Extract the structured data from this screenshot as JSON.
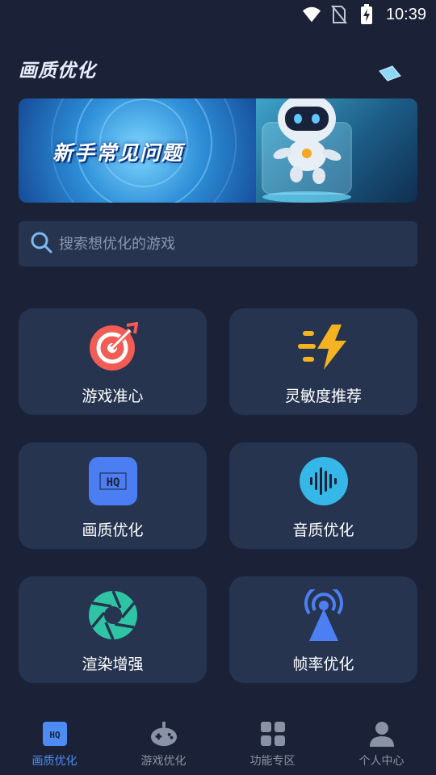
{
  "status_bar": {
    "time": "10:39",
    "icons": [
      "wifi-icon",
      "no-sim-icon",
      "battery-charging-icon"
    ]
  },
  "header": {
    "title": "画质优化"
  },
  "banner": {
    "text": "新手常见问题",
    "image": "robot-mascot"
  },
  "search": {
    "placeholder": "搜索想优化的游戏",
    "value": ""
  },
  "features": [
    {
      "label": "游戏准心",
      "icon": "crosshair-target-icon",
      "color": "#f25c54"
    },
    {
      "label": "灵敏度推荐",
      "icon": "lightning-speed-icon",
      "color": "#f5b321"
    },
    {
      "label": "画质优化",
      "icon": "hq-icon",
      "color": "#4b7ef2"
    },
    {
      "label": "音质优化",
      "icon": "sound-wave-icon",
      "color": "#35b8e8"
    },
    {
      "label": "渲染增强",
      "icon": "aperture-icon",
      "color": "#2ec4a4"
    },
    {
      "label": "帧率优化",
      "icon": "signal-tower-icon",
      "color": "#4d7ff3"
    }
  ],
  "bottom_nav": {
    "active": 0,
    "items": [
      {
        "label": "画质优化",
        "icon": "hq-icon"
      },
      {
        "label": "游戏优化",
        "icon": "gamepad-icon"
      },
      {
        "label": "功能专区",
        "icon": "grid-icon"
      },
      {
        "label": "个人中心",
        "icon": "person-icon"
      }
    ]
  },
  "colors": {
    "background": "#1b2237",
    "card": "#263450",
    "accent": "#4d8cf5",
    "muted_text": "#8a93a6"
  }
}
